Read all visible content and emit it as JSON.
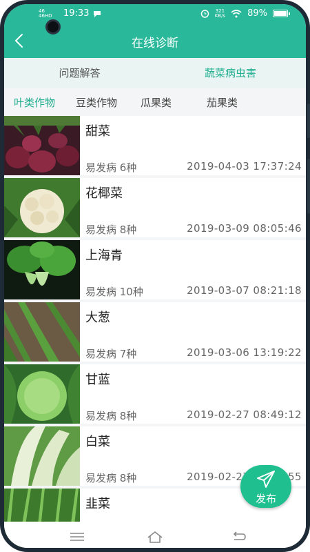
{
  "status_bar": {
    "signal_text": "46 46HD",
    "time": "19:33",
    "speed_value": "321",
    "speed_unit": "KB/s",
    "battery": "89%",
    "battery_level": 0.89
  },
  "header": {
    "title": "在线诊断",
    "back_icon": "chevron-left-icon"
  },
  "top_tabs": [
    {
      "label": "问题解答",
      "active": false
    },
    {
      "label": "蔬菜病虫害",
      "active": true
    }
  ],
  "category_tabs": [
    {
      "label": "叶类作物",
      "active": true
    },
    {
      "label": "豆类作物",
      "active": false
    },
    {
      "label": "瓜果类",
      "active": false
    },
    {
      "label": "茄果类",
      "active": false
    }
  ],
  "vegetables": [
    {
      "name": "甜菜",
      "diseases": "易发病 6种",
      "time": "2019-04-03 17:37:24"
    },
    {
      "name": "花椰菜",
      "diseases": "易发病 8种",
      "time": "2019-03-09 08:05:46"
    },
    {
      "name": "上海青",
      "diseases": "易发病 10种",
      "time": "2019-03-07 08:21:18"
    },
    {
      "name": "大葱",
      "diseases": "易发病 7种",
      "time": "2019-03-06 13:19:22"
    },
    {
      "name": "甘蓝",
      "diseases": "易发病 8种",
      "time": "2019-02-27 08:49:12"
    },
    {
      "name": "白菜",
      "diseases": "易发病 8种",
      "time": "2019-02-27 08:49:55"
    },
    {
      "name": "韭菜",
      "diseases": "",
      "time": ""
    }
  ],
  "fab": {
    "label": "发布",
    "icon": "paper-plane-icon"
  },
  "colors": {
    "accent": "#2ab89a",
    "active_tab": "#1fae8f",
    "fab": "#1fbf8f"
  }
}
